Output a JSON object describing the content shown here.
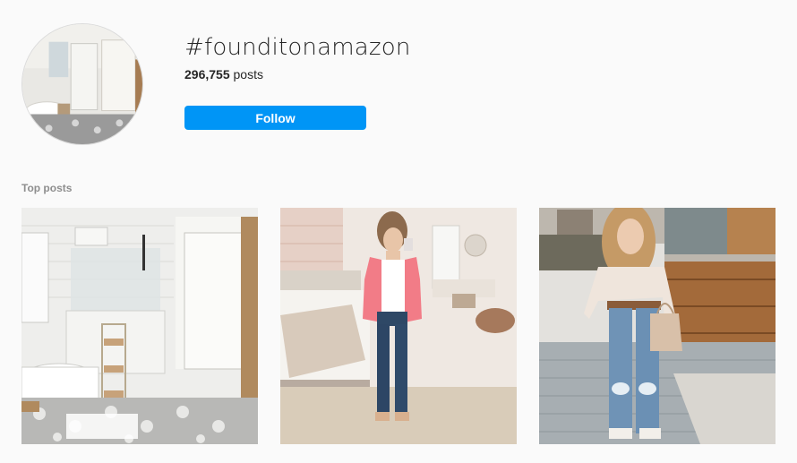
{
  "hashtag": {
    "title": "#founditonamazon",
    "post_count": "296,755",
    "post_count_suffix": " posts",
    "follow_label": "Follow"
  },
  "sections": {
    "top_posts_label": "Top posts"
  },
  "colors": {
    "background": "#fafafa",
    "follow_button": "#0095f6",
    "text_primary": "#262626",
    "text_secondary": "#8e8e8e"
  },
  "top_posts": [
    {
      "image": "bathroom-interior-photo"
    },
    {
      "image": "bedroom-outfit-photo"
    },
    {
      "image": "street-outfit-photo"
    }
  ]
}
